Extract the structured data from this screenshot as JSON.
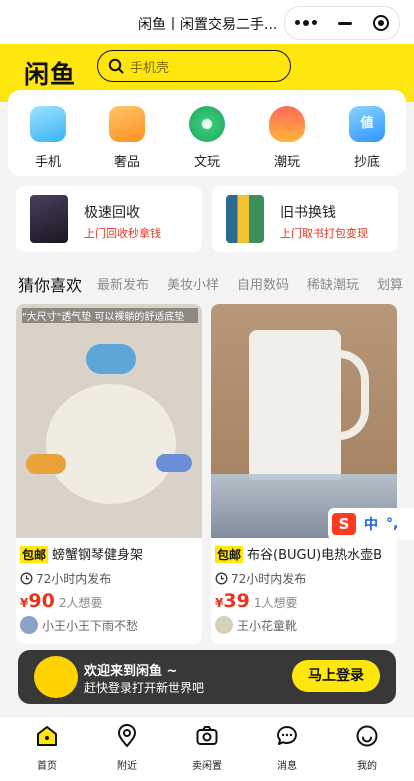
{
  "titlebar": {
    "title": "闲鱼丨闲置交易二手..."
  },
  "header": {
    "logo": "闲鱼",
    "search_placeholder": "手机壳"
  },
  "categories": [
    {
      "label": "手机",
      "icon": "phone-icon",
      "color": "#5bc8ff"
    },
    {
      "label": "奢品",
      "icon": "handbag-icon",
      "color": "#ffa236"
    },
    {
      "label": "文玩",
      "icon": "jade-icon",
      "color": "#35c97a"
    },
    {
      "label": "潮玩",
      "icon": "toy-bear-icon",
      "color": "#ff8a3d"
    },
    {
      "label": "抄底",
      "icon": "value-tag-icon",
      "color": "#3aa7ff"
    }
  ],
  "promos": [
    {
      "title": "极速回收",
      "subtitle": "上门回收秒拿钱"
    },
    {
      "title": "旧书换钱",
      "subtitle": "上门取书打包变现"
    }
  ],
  "tabs": [
    "猜你喜欢",
    "最新发布",
    "美妆小样",
    "自用数码",
    "稀缺潮玩",
    "划算"
  ],
  "cards": [
    {
      "tag": "包邮",
      "title": "螃蟹钢琴健身架",
      "time": "72小时内发布",
      "currency": "¥",
      "price": "90",
      "wants": "2人想要",
      "seller": "小王小王下雨不愁",
      "image_text": "\"大尺寸\"透气垫 可以裸躺的舒适底垫"
    },
    {
      "tag": "包邮",
      "title": "布谷(BUGU)电热水壶B",
      "time": "72小时内发布",
      "currency": "¥",
      "price": "39",
      "wants": "1人想要",
      "seller": "王小花童靴"
    }
  ],
  "banner": {
    "line1": "欢迎来到闲鱼 ~",
    "line2": "赶快登录打开新世界吧",
    "button": "马上登录"
  },
  "ime": {
    "label": "中"
  },
  "nav": [
    {
      "label": "首页",
      "icon": "home-icon"
    },
    {
      "label": "附近",
      "icon": "location-icon"
    },
    {
      "label": "卖闲置",
      "icon": "camera-icon"
    },
    {
      "label": "消息",
      "icon": "message-icon"
    },
    {
      "label": "我的",
      "icon": "profile-icon"
    }
  ],
  "colors": {
    "brand_yellow": "#ffe60f",
    "price_red": "#e8341c"
  }
}
